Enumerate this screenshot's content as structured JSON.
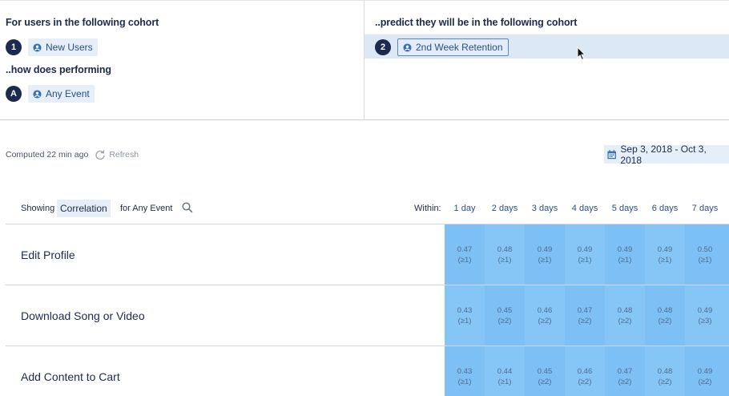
{
  "left_panel": {
    "heading": "For users in the following cohort",
    "cohort_badge": "1",
    "cohort_label": "New Users",
    "performing_heading": "..how does performing",
    "event_badge": "A",
    "event_label": "Any Event"
  },
  "right_panel": {
    "heading": "..predict they will be in the following cohort",
    "cohort_badge": "2",
    "cohort_label": "2nd Week Retention"
  },
  "status": {
    "computed": "Computed 22 min ago",
    "refresh": "Refresh",
    "date_range": "Sep 3, 2018 - Oct 3, 2018"
  },
  "table": {
    "showing_label": "Showing",
    "metric": "Correlation",
    "for_event": "for Any Event",
    "within_label": "Within:",
    "day_headers": [
      "1 day",
      "2 days",
      "3 days",
      "4 days",
      "5 days",
      "6 days",
      "7 days"
    ],
    "rows": [
      {
        "name": "Edit Profile",
        "values": [
          "0.47",
          "0.48",
          "0.49",
          "0.49",
          "0.49",
          "0.49",
          "0.50"
        ],
        "counts": [
          "(≥1)",
          "(≥1)",
          "(≥1)",
          "(≥1)",
          "(≥1)",
          "(≥1)",
          "(≥1)"
        ]
      },
      {
        "name": "Download Song or Video",
        "values": [
          "0.43",
          "0.45",
          "0.46",
          "0.47",
          "0.48",
          "0.48",
          "0.49"
        ],
        "counts": [
          "(≥1)",
          "(≥2)",
          "(≥2)",
          "(≥2)",
          "(≥2)",
          "(≥2)",
          "(≥3)"
        ]
      },
      {
        "name": "Add Content to Cart",
        "values": [
          "0.43",
          "0.44",
          "0.45",
          "0.46",
          "0.47",
          "0.48",
          "0.49"
        ],
        "counts": [
          "(≥1)",
          "(≥1)",
          "(≥2)",
          "(≥2)",
          "(≥2)",
          "(≥2)",
          "(≥2)"
        ]
      }
    ]
  },
  "colors": {
    "cell_fill": "#7cc0f5",
    "cell_fill_alt": "#86c6f6",
    "badge": "#1b2a4e",
    "chip_bg": "#e6eef8",
    "selected_row": "#dce8f6"
  },
  "icons": [
    "cohort-icon",
    "event-icon",
    "refresh-icon",
    "calendar-icon",
    "search-icon",
    "mouse-cursor-icon"
  ]
}
